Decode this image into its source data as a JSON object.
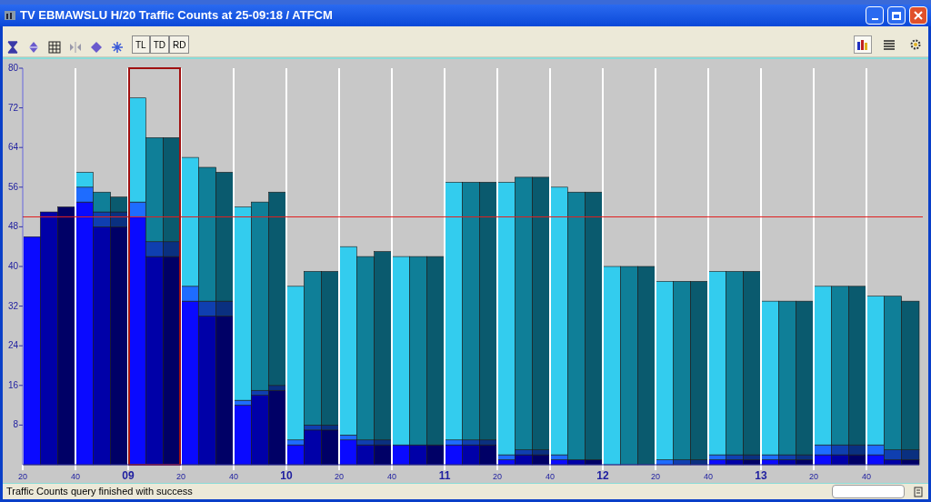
{
  "window": {
    "title": "TV EBMAWSLU H/20 Traffic Counts at 25-09:18 / ATFCM"
  },
  "toolbar": {
    "left_icons": [
      {
        "kind": "hourglass"
      },
      {
        "kind": "diamond-arrows"
      },
      {
        "kind": "grid"
      },
      {
        "kind": "split"
      },
      {
        "kind": "diamond"
      },
      {
        "kind": "snowflake"
      }
    ],
    "toggles": [
      {
        "label": "TL",
        "selected": false
      },
      {
        "label": "TD",
        "selected": false
      },
      {
        "label": "RD",
        "selected": false
      }
    ],
    "right_icons": [
      {
        "kind": "bar-chart",
        "selected": true
      },
      {
        "kind": "list",
        "selected": false
      },
      {
        "kind": "gear",
        "selected": false
      }
    ]
  },
  "chart": {
    "chart_data": {
      "type": "bar",
      "stacked": true,
      "grid": true,
      "ylim": [
        0,
        80
      ],
      "yticks": [
        8,
        16,
        24,
        32,
        40,
        48,
        56,
        64,
        72,
        80
      ],
      "categories": [
        "20",
        null,
        null,
        "40",
        null,
        null,
        "09",
        null,
        null,
        "20",
        null,
        null,
        "40",
        null,
        null,
        "10",
        null,
        null,
        "20",
        null,
        null,
        "40",
        null,
        null,
        "11",
        null,
        null,
        "20",
        null,
        null,
        "40",
        null,
        null,
        "12",
        null,
        null,
        "20",
        null,
        null,
        "40",
        null,
        null,
        "13",
        null,
        null,
        "20",
        null,
        null,
        "40",
        null,
        null
      ],
      "series": [
        {
          "color": "#0a0aff",
          "values": [
            46,
            null,
            null,
            53,
            null,
            null,
            50,
            null,
            null,
            33,
            null,
            null,
            12,
            null,
            null,
            4,
            null,
            null,
            5,
            null,
            null,
            4,
            null,
            null,
            4,
            null,
            null,
            1,
            null,
            null,
            1,
            null,
            null,
            0,
            null,
            null,
            0,
            null,
            null,
            1,
            null,
            null,
            1,
            null,
            null,
            2,
            null,
            null,
            2,
            null,
            null
          ]
        },
        {
          "color": "#1e6cff",
          "values": [
            0,
            null,
            null,
            3,
            null,
            null,
            3,
            null,
            null,
            3,
            null,
            null,
            1,
            null,
            null,
            1,
            null,
            null,
            1,
            null,
            null,
            0,
            null,
            null,
            1,
            null,
            null,
            1,
            null,
            null,
            1,
            null,
            null,
            0,
            null,
            null,
            1,
            null,
            null,
            1,
            null,
            null,
            1,
            null,
            null,
            2,
            null,
            null,
            2,
            null,
            null
          ]
        },
        {
          "color": "#33ccee",
          "values": [
            0,
            null,
            null,
            3,
            null,
            null,
            21,
            null,
            null,
            26,
            null,
            null,
            39,
            null,
            null,
            31,
            null,
            null,
            38,
            null,
            null,
            38,
            null,
            null,
            52,
            null,
            null,
            55,
            null,
            null,
            54,
            null,
            null,
            40,
            null,
            null,
            36,
            null,
            null,
            37,
            null,
            null,
            31,
            null,
            null,
            32,
            null,
            null,
            30,
            null,
            null
          ]
        },
        {
          "color": "#0000a8",
          "values": [
            null,
            51,
            null,
            null,
            48,
            null,
            null,
            42,
            null,
            null,
            30,
            null,
            null,
            14,
            null,
            null,
            7,
            null,
            null,
            4,
            null,
            null,
            4,
            null,
            null,
            4,
            null,
            null,
            2,
            null,
            null,
            1,
            null,
            null,
            0,
            null,
            null,
            0,
            null,
            null,
            1,
            null,
            null,
            1,
            null,
            null,
            2,
            null,
            null,
            1,
            null
          ]
        },
        {
          "color": "#0f3fb0",
          "values": [
            null,
            0,
            null,
            null,
            3,
            null,
            null,
            3,
            null,
            null,
            3,
            null,
            null,
            1,
            null,
            null,
            1,
            null,
            null,
            1,
            null,
            null,
            0,
            null,
            null,
            1,
            null,
            null,
            1,
            null,
            null,
            0,
            null,
            null,
            0,
            null,
            null,
            1,
            null,
            null,
            1,
            null,
            null,
            1,
            null,
            null,
            2,
            null,
            null,
            2,
            null
          ]
        },
        {
          "color": "#0f7f98",
          "values": [
            null,
            0,
            null,
            null,
            4,
            null,
            null,
            21,
            null,
            null,
            27,
            null,
            null,
            38,
            null,
            null,
            31,
            null,
            null,
            37,
            null,
            null,
            38,
            null,
            null,
            52,
            null,
            null,
            55,
            null,
            null,
            54,
            null,
            null,
            40,
            null,
            null,
            36,
            null,
            null,
            37,
            null,
            null,
            31,
            null,
            null,
            32,
            null,
            null,
            31,
            null
          ]
        },
        {
          "color": "#000066",
          "values": [
            null,
            null,
            52,
            null,
            null,
            48,
            null,
            null,
            42,
            null,
            null,
            30,
            null,
            null,
            15,
            null,
            null,
            7,
            null,
            null,
            4,
            null,
            null,
            4,
            null,
            null,
            4,
            null,
            null,
            2,
            null,
            null,
            1,
            null,
            null,
            0,
            null,
            null,
            0,
            null,
            null,
            1,
            null,
            null,
            1,
            null,
            null,
            2,
            null,
            null,
            1
          ]
        },
        {
          "color": "#0a3080",
          "values": [
            null,
            null,
            0,
            null,
            null,
            3,
            null,
            null,
            3,
            null,
            null,
            3,
            null,
            null,
            1,
            null,
            null,
            1,
            null,
            null,
            1,
            null,
            null,
            0,
            null,
            null,
            1,
            null,
            null,
            1,
            null,
            null,
            0,
            null,
            null,
            0,
            null,
            null,
            1,
            null,
            null,
            1,
            null,
            null,
            1,
            null,
            null,
            2,
            null,
            null,
            2
          ]
        },
        {
          "color": "#0a5a6e",
          "values": [
            null,
            null,
            0,
            null,
            null,
            3,
            null,
            null,
            21,
            null,
            null,
            26,
            null,
            null,
            39,
            null,
            null,
            31,
            null,
            null,
            38,
            null,
            null,
            38,
            null,
            null,
            52,
            null,
            null,
            55,
            null,
            null,
            54,
            null,
            null,
            40,
            null,
            null,
            36,
            null,
            null,
            37,
            null,
            null,
            31,
            null,
            null,
            32,
            null,
            null,
            30
          ]
        }
      ],
      "ref_lines": [
        {
          "axis": "y",
          "value": 50,
          "color": "#e02020"
        }
      ]
    },
    "slots": [
      {
        "selected": false
      },
      {
        "selected": false
      },
      {
        "selected": true
      },
      {
        "selected": false
      },
      {
        "selected": false
      },
      {
        "selected": false
      },
      {
        "selected": false
      },
      {
        "selected": false
      },
      {
        "selected": false
      },
      {
        "selected": false
      },
      {
        "selected": false
      },
      {
        "selected": false
      },
      {
        "selected": false
      },
      {
        "selected": false
      },
      {
        "selected": false
      },
      {
        "selected": false
      },
      {
        "selected": false
      }
    ]
  },
  "status_bar": {
    "message": "Traffic Counts query finished with success"
  }
}
